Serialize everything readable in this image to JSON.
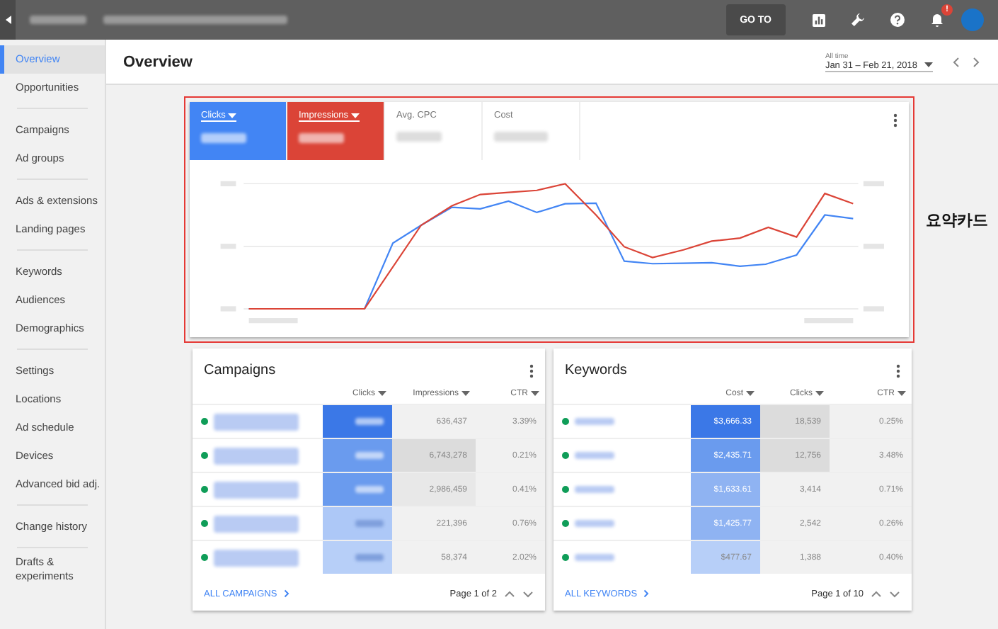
{
  "top_bar": {
    "buttons": [
      {
        "kind": "text",
        "label": "GO TO"
      },
      {
        "kind": "chart"
      },
      {
        "kind": "wrench"
      },
      {
        "kind": "help"
      },
      {
        "kind": "bell",
        "badge": "!"
      }
    ]
  },
  "sidebar": {
    "groups": [
      [
        {
          "label": "Overview",
          "selected": true
        },
        {
          "label": "Opportunities",
          "selected": false
        }
      ],
      [
        {
          "label": "Campaigns",
          "selected": false
        },
        {
          "label": "Ad groups",
          "selected": false
        }
      ],
      [
        {
          "label": "Ads & extensions",
          "selected": false
        },
        {
          "label": "Landing pages",
          "selected": false
        }
      ],
      [
        {
          "label": "Keywords",
          "selected": false
        },
        {
          "label": "Audiences",
          "selected": false
        },
        {
          "label": "Demographics",
          "selected": false
        }
      ],
      [
        {
          "label": "Settings",
          "selected": false
        },
        {
          "label": "Locations",
          "selected": false
        },
        {
          "label": "Ad schedule",
          "selected": false
        },
        {
          "label": "Devices",
          "selected": false
        },
        {
          "label": "Advanced bid adj.",
          "selected": false
        }
      ],
      [
        {
          "label": "Change history",
          "selected": false
        }
      ],
      [
        {
          "label": "Drafts & experiments",
          "selected": false
        }
      ]
    ]
  },
  "header": {
    "title": "Overview",
    "range_label": "All time",
    "range": "Jan 31 – Feb 21, 2018"
  },
  "summary": {
    "metrics": [
      {
        "label": "Clicks",
        "selected": true,
        "color": "#4285f4"
      },
      {
        "label": "Impressions",
        "selected": true,
        "color": "#db4437"
      },
      {
        "label": "Avg. CPC",
        "selected": false
      },
      {
        "label": "Cost",
        "selected": false
      }
    ],
    "annotation": "요약카드"
  },
  "cards": [
    {
      "title": "Campaigns",
      "columns": [
        "Clicks",
        "Impressions",
        "CTR"
      ],
      "footer_link": "ALL CAMPAIGNS",
      "page": "Page 1 of 2",
      "rows": [
        {
          "cells": [
            {
              "color": "#3b78e7"
            },
            {
              "text": "636,437",
              "color": "#f1f1f1"
            },
            {
              "text": "3.39%",
              "color": "#f1f1f1"
            }
          ]
        },
        {
          "cells": [
            {
              "color": "#6a9bee"
            },
            {
              "text": "6,743,278",
              "color": "#dcdcdc"
            },
            {
              "text": "0.21%",
              "color": "#f1f1f1"
            }
          ]
        },
        {
          "cells": [
            {
              "color": "#6a9bee"
            },
            {
              "text": "2,986,459",
              "color": "#e8e8e8"
            },
            {
              "text": "0.41%",
              "color": "#f1f1f1"
            }
          ]
        },
        {
          "cells": [
            {
              "color": "#adc8f7"
            },
            {
              "text": "221,396",
              "color": "#f1f1f1"
            },
            {
              "text": "0.76%",
              "color": "#f1f1f1"
            }
          ]
        },
        {
          "cells": [
            {
              "color": "#b7cff8"
            },
            {
              "text": "58,374",
              "color": "#f1f1f1"
            },
            {
              "text": "2.02%",
              "color": "#f1f1f1"
            }
          ]
        }
      ]
    },
    {
      "title": "Keywords",
      "columns": [
        "Cost",
        "Clicks",
        "CTR"
      ],
      "footer_link": "ALL KEYWORDS",
      "page": "Page 1 of 10",
      "rows": [
        {
          "cells": [
            {
              "text": "$3,666.33",
              "color": "#3b78e7"
            },
            {
              "text": "18,539",
              "color": "#dcdcdc"
            },
            {
              "text": "0.25%",
              "color": "#f1f1f1"
            }
          ]
        },
        {
          "cells": [
            {
              "text": "$2,435.71",
              "color": "#6a9bee"
            },
            {
              "text": "12,756",
              "color": "#dcdcdc"
            },
            {
              "text": "3.48%",
              "color": "#f1f1f1"
            }
          ]
        },
        {
          "cells": [
            {
              "text": "$1,633.61",
              "color": "#8fb3f2"
            },
            {
              "text": "3,414",
              "color": "#f1f1f1"
            },
            {
              "text": "0.71%",
              "color": "#f1f1f1"
            }
          ]
        },
        {
          "cells": [
            {
              "text": "$1,425.77",
              "color": "#8fb3f2"
            },
            {
              "text": "2,542",
              "color": "#f1f1f1"
            },
            {
              "text": "0.26%",
              "color": "#f1f1f1"
            }
          ]
        },
        {
          "cells": [
            {
              "text": "$477.67",
              "color": "#b7cff8"
            },
            {
              "text": "1,388",
              "color": "#f1f1f1"
            },
            {
              "text": "0.40%",
              "color": "#f1f1f1"
            }
          ]
        }
      ]
    }
  ]
}
